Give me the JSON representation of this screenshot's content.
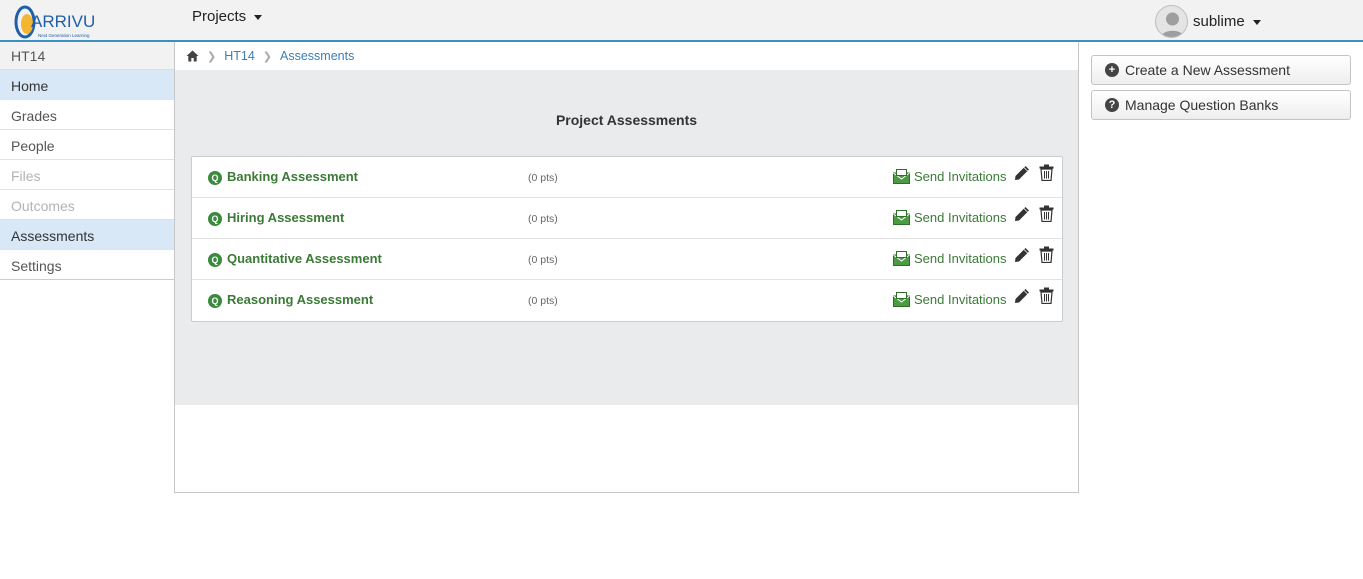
{
  "header": {
    "logo_text": "ARRIVU",
    "logo_tagline": "Next Generation Learning",
    "projects_label": "Projects",
    "user_name": "sublime"
  },
  "sidebar": {
    "course": "HT14",
    "items": [
      {
        "label": "Home",
        "state": "active"
      },
      {
        "label": "Grades",
        "state": "normal"
      },
      {
        "label": "People",
        "state": "normal"
      },
      {
        "label": "Files",
        "state": "disabled"
      },
      {
        "label": "Outcomes",
        "state": "disabled"
      },
      {
        "label": "Assessments",
        "state": "active"
      },
      {
        "label": "Settings",
        "state": "normal"
      }
    ]
  },
  "breadcrumb": [
    "HT14",
    "Assessments"
  ],
  "main": {
    "title": "Project Assessments",
    "q_badge": "Q",
    "send_label": "Send Invitations",
    "assessments": [
      {
        "name": "Banking Assessment",
        "points": "(0 pts)"
      },
      {
        "name": "Hiring Assessment",
        "points": "(0 pts)"
      },
      {
        "name": "Quantitative Assessment",
        "points": "(0 pts)"
      },
      {
        "name": "Reasoning Assessment",
        "points": "(0 pts)"
      }
    ]
  },
  "actions": {
    "create_label": "Create a New Assessment",
    "manage_label": "Manage Question Banks"
  },
  "colors": {
    "accent_blue": "#3a8fc5",
    "link_green": "#3b7a37",
    "active_nav": "#d8e8f7"
  }
}
